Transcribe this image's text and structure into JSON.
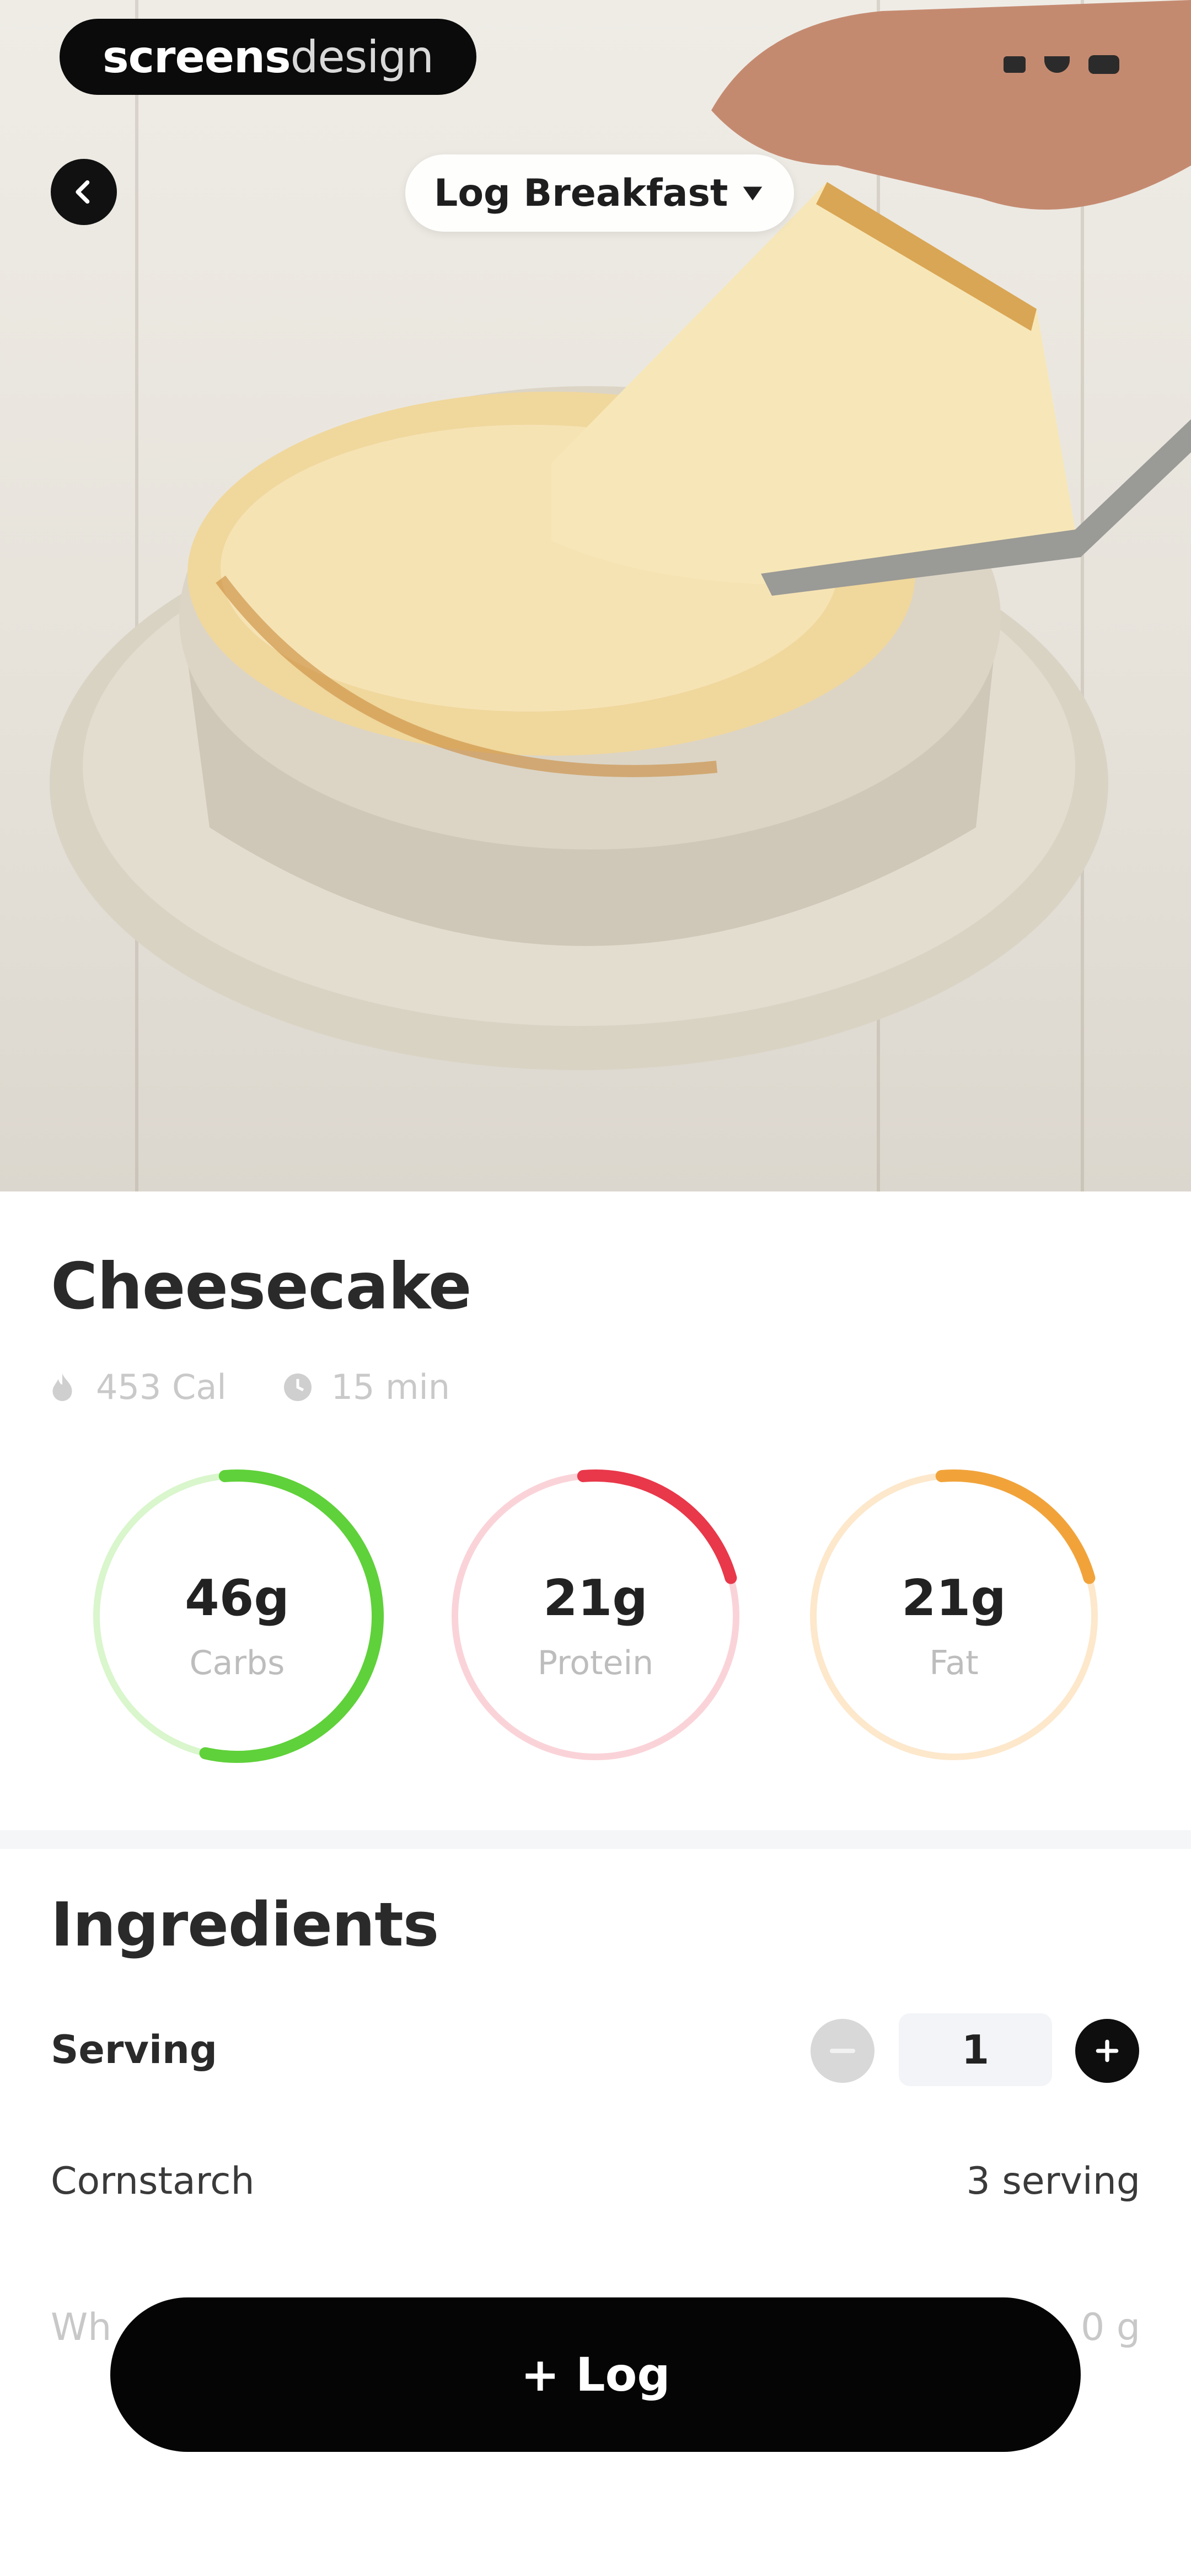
{
  "brand": {
    "part1": "screens",
    "part2": "design"
  },
  "header": {
    "meal_selector": "Log Breakfast"
  },
  "food": {
    "name": "Cheesecake",
    "calories": "453 Cal",
    "time": "15 min"
  },
  "macros": [
    {
      "value": "46g",
      "label": "Carbs",
      "progress": 0.55,
      "color": "#5fd13a",
      "track": "#d9f6cc"
    },
    {
      "value": "21g",
      "label": "Protein",
      "progress": 0.22,
      "color": "#e8384a",
      "track": "#fad3d8"
    },
    {
      "value": "21g",
      "label": "Fat",
      "progress": 0.22,
      "color": "#f1a33a",
      "track": "#fde8cc"
    }
  ],
  "ingredients": {
    "title": "Ingredients",
    "serving_label": "Serving",
    "serving_qty": "1",
    "items": [
      {
        "name": "Cornstarch",
        "amount": "3 serving"
      },
      {
        "name": "Wh",
        "amount": "0 g"
      }
    ]
  },
  "log_button": "+ Log"
}
